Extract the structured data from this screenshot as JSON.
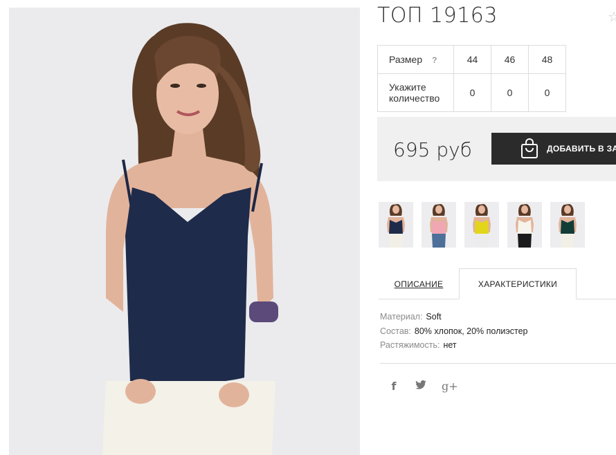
{
  "product": {
    "title": "ТОП 19163",
    "favorite_icon": "star-icon"
  },
  "size_table": {
    "size_label": "Размер",
    "size_hint": "?",
    "quantity_label": "Укажите количество",
    "sizes": [
      "44",
      "46",
      "48"
    ],
    "quantities": [
      "0",
      "0",
      "0"
    ]
  },
  "purchase": {
    "price": "695 руб",
    "add_to_cart_label": "ДОБАВИТЬ В ЗАКАЗ",
    "cart_icon": "shopping-bag-icon"
  },
  "thumbnails": [
    {
      "color": "#1f2b4a",
      "pants": "#f2f0e6"
    },
    {
      "color": "#f0a6b3",
      "pants": "#4d6f99"
    },
    {
      "color": "#e2d61a",
      "pants": "#ececec"
    },
    {
      "color": "#f6f4ec",
      "pants": "#1b1b1b"
    },
    {
      "color": "#123c36",
      "pants": "#f2f0e6"
    }
  ],
  "tabs": {
    "description": "ОПИСАНИЕ",
    "characteristics": "ХАРАКТЕРИСТИКИ"
  },
  "characteristics": [
    {
      "key": "Материал:",
      "value": "Soft"
    },
    {
      "key": "Состав:",
      "value": "80% хлопок, 20% полиэстер"
    },
    {
      "key": "Растяжимость:",
      "value": "нет"
    }
  ],
  "social": {
    "facebook": "f",
    "google_plus": "g+"
  },
  "colors": {
    "button_bg": "#2b2b2b",
    "price_box_bg": "#f0f0f0",
    "top_color": "#1f2b4a"
  }
}
